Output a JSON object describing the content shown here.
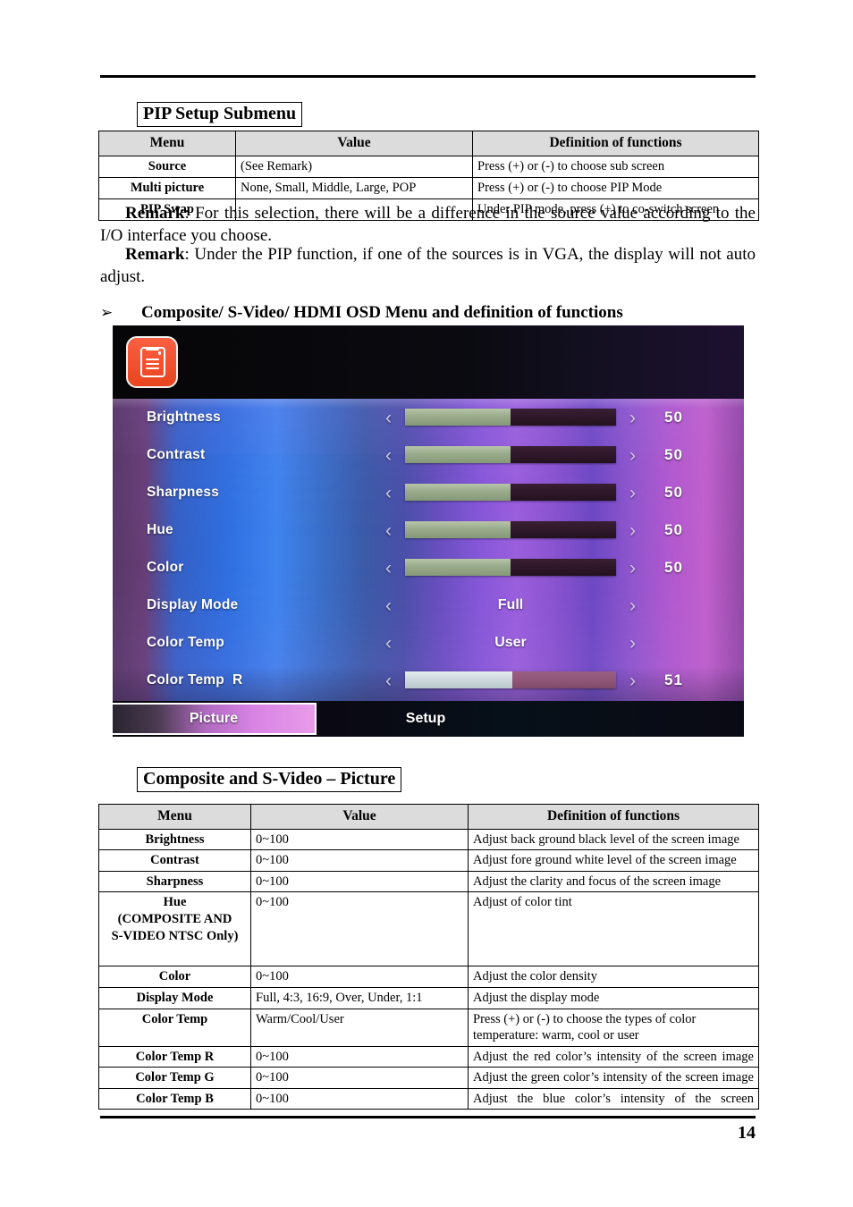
{
  "page": {
    "number": "14"
  },
  "pip_section": {
    "heading": "PIP Setup Submenu",
    "table": {
      "headers": [
        "Menu",
        "Value",
        "Definition of functions"
      ],
      "rows": [
        {
          "menu": "Source",
          "value": "(See Remark)",
          "definition": "Press (+) or (-) to choose sub screen"
        },
        {
          "menu": "Multi picture",
          "value": "None, Small, Middle, Large, POP",
          "definition": "Press (+) or (-) to choose PIP Mode"
        },
        {
          "menu": "PIP Swap",
          "value": "",
          "definition": "Under PIP mode, press (+) to co-switch screen"
        }
      ]
    }
  },
  "remarks": {
    "remark_1_label": "Remark",
    "remark_1_text": ": For this selection, there will be a difference in the source value according to the I/O interface you choose.",
    "remark_2_label": "Remark",
    "remark_2_text": ": Under the PIP function, if one of the sources is in VGA, the display will not auto adjust."
  },
  "bullet": {
    "marker": "➢",
    "text": "Composite/ S-Video/ HDMI OSD Menu and definition of functions"
  },
  "osd": {
    "icon_name": "picture-settings-icon",
    "icon_color": "#f2502f",
    "rows": [
      {
        "label": "Brightness",
        "kind": "bar",
        "fill_percent": 50,
        "number": "50",
        "bright": false
      },
      {
        "label": "Contrast",
        "kind": "bar",
        "fill_percent": 50,
        "number": "50",
        "bright": false
      },
      {
        "label": "Sharpness",
        "kind": "bar",
        "fill_percent": 50,
        "number": "50",
        "bright": false
      },
      {
        "label": "Hue",
        "kind": "bar",
        "fill_percent": 50,
        "number": "50",
        "bright": false
      },
      {
        "label": "Color",
        "kind": "bar",
        "fill_percent": 50,
        "number": "50",
        "bright": false
      },
      {
        "label": "Display Mode",
        "kind": "text",
        "text": "Full",
        "number": ""
      },
      {
        "label": "Color Temp",
        "kind": "text",
        "text": "User",
        "number": ""
      },
      {
        "label": "Color Temp  R",
        "kind": "bar",
        "fill_percent": 51,
        "number": "51",
        "bright": true
      }
    ],
    "arrow_left": "‹",
    "arrow_right": "›",
    "tabs": [
      {
        "label": "Picture",
        "active": true
      },
      {
        "label": "Setup",
        "active": false
      }
    ]
  },
  "composite_section": {
    "heading": "Composite and S-Video – Picture",
    "table": {
      "headers": [
        "Menu",
        "Value",
        "Definition of functions"
      ],
      "rows": [
        {
          "menu": "Brightness",
          "value": "0~100",
          "definition": "Adjust back ground black level of the screen image"
        },
        {
          "menu": "Contrast",
          "value": "0~100",
          "definition": "Adjust fore ground white level of the screen image"
        },
        {
          "menu": "Sharpness",
          "value": "0~100",
          "definition": "Adjust the clarity and focus of the screen image"
        },
        {
          "menu": "Hue\n(COMPOSITE AND\nS-VIDEO NTSC Only)",
          "value": "0~100",
          "definition": "Adjust of color tint"
        },
        {
          "menu": "Color",
          "value": "0~100",
          "definition": "Adjust the color density"
        },
        {
          "menu": "Display Mode",
          "value": "Full, 4:3, 16:9, Over, Under, 1:1",
          "definition": "Adjust the display mode"
        },
        {
          "menu": "Color Temp",
          "value": "Warm/Cool/User",
          "definition": "Press (+) or (-) to choose the types of color temperature: warm, cool or user"
        },
        {
          "menu": "Color Temp R",
          "value": "0~100",
          "definition": "Adjust the red color’s intensity of the screen image"
        },
        {
          "menu": "Color Temp G",
          "value": "0~100",
          "definition": "Adjust the green color’s intensity of the screen image"
        },
        {
          "menu": "Color Temp B",
          "value": "0~100",
          "definition": "Adjust the blue color’s intensity of the screen"
        }
      ]
    }
  }
}
